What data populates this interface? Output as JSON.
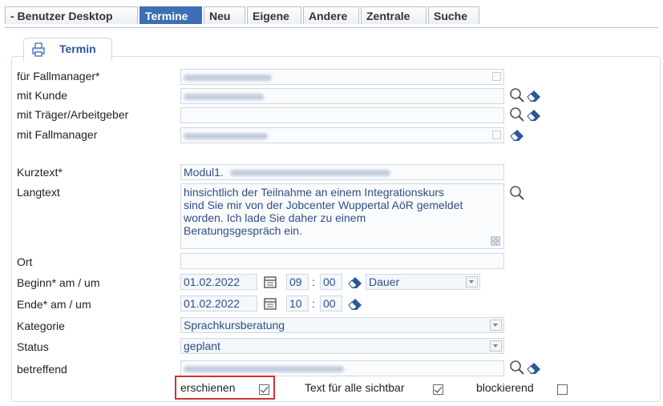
{
  "tabs": [
    {
      "label": "- Benutzer Desktop",
      "active": false
    },
    {
      "label": "Termine",
      "active": true
    },
    {
      "label": "Neu",
      "active": false
    },
    {
      "label": "Eigene",
      "active": false
    },
    {
      "label": "Andere",
      "active": false
    },
    {
      "label": "Zentrale",
      "active": false
    },
    {
      "label": "Suche",
      "active": false
    }
  ],
  "subtab": {
    "label": "Termin",
    "icon": "printer-icon"
  },
  "form": {
    "fallmanager_label": "für Fallmanager*",
    "kunde_label": "mit Kunde",
    "traeger_label": "mit Träger/Arbeitgeber",
    "mit_fallmanager_label": "mit Fallmanager",
    "kurztext_label": "Kurztext*",
    "kurztext_value": "Modul1.",
    "langtext_label": "Langtext",
    "langtext_lines": [
      "hinsichtlich der Teilnahme an einem Integrationskurs",
      "sind Sie mir von der Jobcenter Wuppertal AöR gemeldet",
      "worden. Ich lade Sie daher zu einem",
      "Beratungsgespräch ein."
    ],
    "ort_label": "Ort",
    "beginn_label": "Beginn* am / um",
    "beginn_date": "01.02.2022",
    "beginn_hour": "09",
    "beginn_minute": "00",
    "dauer_value": "Dauer",
    "ende_label": "Ende* am / um",
    "ende_date": "01.02.2022",
    "ende_hour": "10",
    "ende_minute": "00",
    "time_sep": ":",
    "kategorie_label": "Kategorie",
    "kategorie_value": "Sprachkursberatung",
    "status_label": "Status",
    "status_value": "geplant",
    "betreffend_label": "betreffend",
    "erschienen_label": "erschienen",
    "erschienen_checked": true,
    "sichtbar_label": "Text für alle sichtbar",
    "sichtbar_checked": true,
    "blockierend_label": "blockierend",
    "blockierend_checked": false
  },
  "colors": {
    "accent": "#3d6fb4",
    "field_bg": "#f4f7fb",
    "highlight": "#d23232"
  }
}
